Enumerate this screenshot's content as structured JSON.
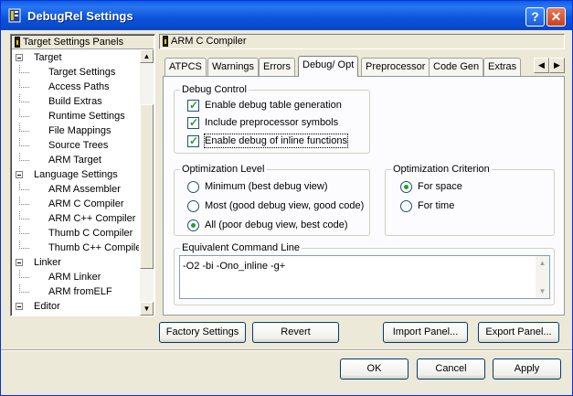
{
  "window": {
    "title": "DebugRel Settings"
  },
  "tree": {
    "header": "Target Settings Panels",
    "items": [
      {
        "label": "Target",
        "level": 0,
        "expanded": true
      },
      {
        "label": "Target Settings",
        "level": 1
      },
      {
        "label": "Access Paths",
        "level": 1
      },
      {
        "label": "Build Extras",
        "level": 1
      },
      {
        "label": "Runtime Settings",
        "level": 1
      },
      {
        "label": "File Mappings",
        "level": 1
      },
      {
        "label": "Source Trees",
        "level": 1
      },
      {
        "label": "ARM Target",
        "level": 1
      },
      {
        "label": "Language Settings",
        "level": 0,
        "expanded": true
      },
      {
        "label": "ARM Assembler",
        "level": 1
      },
      {
        "label": "ARM C Compiler",
        "level": 1
      },
      {
        "label": "ARM C++ Compiler",
        "level": 1
      },
      {
        "label": "Thumb C Compiler",
        "level": 1
      },
      {
        "label": "Thumb C++ Compiler",
        "level": 1
      },
      {
        "label": "Linker",
        "level": 0,
        "expanded": true
      },
      {
        "label": "ARM Linker",
        "level": 1
      },
      {
        "label": "ARM fromELF",
        "level": 1
      },
      {
        "label": "Editor",
        "level": 0,
        "expanded": true
      }
    ]
  },
  "panel": {
    "header": "ARM C Compiler",
    "tabs": [
      "ATPCS",
      "Warnings",
      "Errors",
      "Debug/ Opt",
      "Preprocessor",
      "Code Gen",
      "Extras"
    ],
    "active_tab": "Debug/ Opt"
  },
  "debug_control": {
    "title": "Debug Control",
    "options": [
      {
        "label": "Enable debug table generation",
        "checked": true
      },
      {
        "label": "Include preprocessor symbols",
        "checked": true
      },
      {
        "label": "Enable debug of inline functions",
        "checked": true
      }
    ]
  },
  "optimization_level": {
    "title": "Optimization Level",
    "options": [
      {
        "label": "Minimum (best debug view)",
        "selected": false
      },
      {
        "label": "Most (good debug view, good code)",
        "selected": false
      },
      {
        "label": "All (poor debug view, best code)",
        "selected": true
      }
    ]
  },
  "optimization_criterion": {
    "title": "Optimization Criterion",
    "options": [
      {
        "label": "For space",
        "selected": true
      },
      {
        "label": "For time",
        "selected": false
      }
    ]
  },
  "command_line": {
    "title": "Equivalent Command Line",
    "value": "-O2 -bi -Ono_inline  -g+"
  },
  "panel_buttons": {
    "factory": "Factory Settings",
    "revert": "Revert",
    "import": "Import Panel...",
    "export": "Export Panel..."
  },
  "dialog_buttons": {
    "ok": "OK",
    "cancel": "Cancel",
    "apply": "Apply"
  },
  "icons": {
    "help": "help-icon",
    "close": "close-icon",
    "app": "app-icon"
  },
  "colors": {
    "titlebar": "#0a53d9",
    "dialog_bg": "#ece9d8",
    "check": "#21a121"
  }
}
